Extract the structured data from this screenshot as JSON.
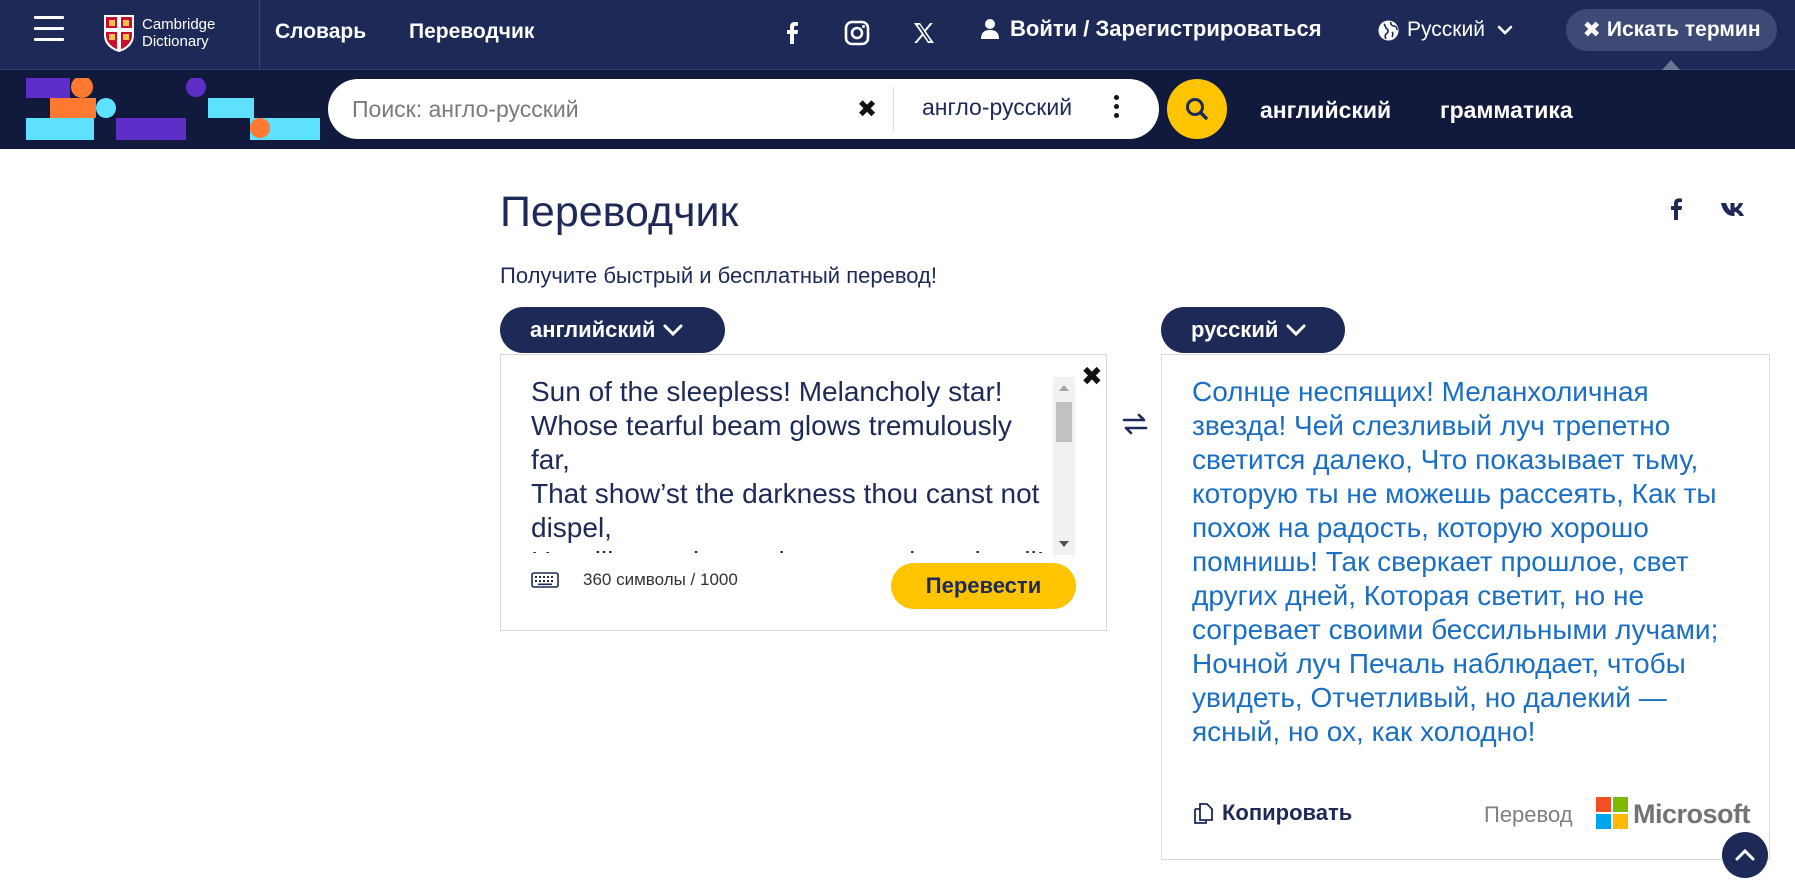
{
  "header": {
    "logo_line1": "Cambridge",
    "logo_line2": "Dictionary",
    "nav": [
      "Словарь",
      "Переводчик"
    ],
    "social_icons": [
      "facebook-icon",
      "instagram-icon",
      "x-twitter-icon"
    ],
    "login_label": "Войти / Зарегистрироваться",
    "language_label": "Русский",
    "search_term_label": "Искать термин"
  },
  "search": {
    "placeholder": "Поиск: англо-русский",
    "dictionary": "англо-русский",
    "nav": [
      "английский",
      "грамматика"
    ]
  },
  "page": {
    "title": "Переводчик",
    "subtitle": "Получите быстрый и бесплатный перевод!",
    "share_icons": [
      "facebook-icon",
      "vk-icon"
    ]
  },
  "translator": {
    "source_lang": "английский",
    "target_lang": "русский",
    "source_text": "Sun of the sleepless! Melancholy star!\nWhose tearful beam glows tremulously far,\nThat show’st the darkness thou canst not dispel,\nHow like art thou to joy remembered well!",
    "char_count": "360 символы / 1000",
    "translate_label": "Перевести",
    "target_text": "Солнце неспящих! Меланхоличная звезда! Чей слезливый луч трепетно светится далеко, Что показывает тьму, которую ты не можешь рассеять, Как ты похож на радость, которую хорошо помнишь! Так сверкает прошлое, свет других дней, Которая светит, но не согревает своими бессильными лучами; Ночной луч Печаль наблюдает, чтобы увидеть, Отчетливый, но далекий — ясный, но ох, как холодно!",
    "copy_label": "Копировать",
    "powered_by": "Перевод",
    "provider": "Microsoft"
  },
  "colors": {
    "navy": "#1d2a57",
    "dark_navy": "#111a3d",
    "yellow": "#fec400",
    "translation_blue": "#1a6ec4"
  }
}
